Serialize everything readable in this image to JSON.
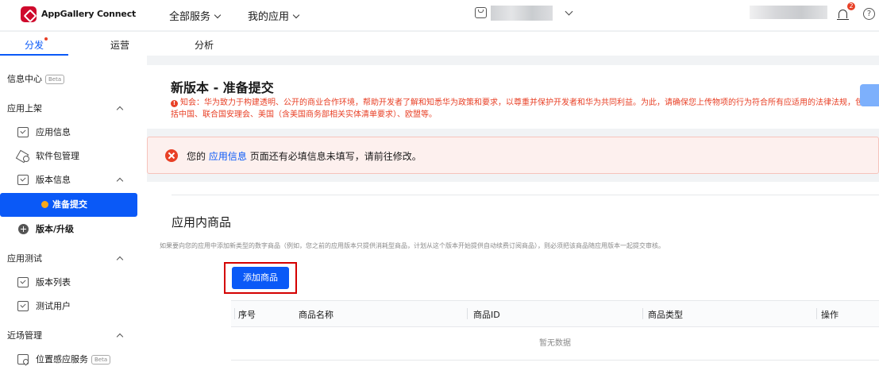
{
  "topbar": {
    "brand": "AppGallery Connect",
    "nav": [
      "全部服务",
      "我的应用"
    ],
    "notification_count": "2",
    "help": "?"
  },
  "tabs": [
    "分发",
    "运营",
    "分析"
  ],
  "sidebar": {
    "info_center": "信息中心",
    "beta": "Beta",
    "app_launch": "应用上架",
    "app_info": "应用信息",
    "package_mgmt": "软件包管理",
    "version_info": "版本信息",
    "prepare_submit": "准备提交",
    "version_upgrade": "版本/升级",
    "app_test": "应用测试",
    "version_list": "版本列表",
    "test_users": "测试用户",
    "nearby_mgmt": "近场管理",
    "location_service": "位置感应服务"
  },
  "header": {
    "title": "新版本 - 准备提交",
    "notice_icon": "!",
    "notice": "知会：华为致力于构建透明、公开的商业合作环境，帮助开发者了解和知悉华为政策和要求，以尊重并保护开发者和华为共同利益。为此，请确保您上传物项的行为符合所有应适用的法律法规，包括中国、联合国安理会、美国（含美国商务部相关实体清单要求）、欧盟等。"
  },
  "alert": {
    "prefix": "您的",
    "link": "应用信息",
    "suffix": "页面还有必填信息未填写，请前往修改。"
  },
  "iap": {
    "title": "应用内商品",
    "desc": "如果要向您的应用中添加新类型的数字商品（例如，您之前的应用版本只提供消耗型商品，计划从这个版本开始提供自动续费订阅商品），则必须把该商品随应用版本一起提交审核。",
    "add_button": "添加商品",
    "columns": [
      "序号",
      "商品名称",
      "商品ID",
      "商品类型",
      "操作"
    ],
    "empty": "暂无数据"
  }
}
